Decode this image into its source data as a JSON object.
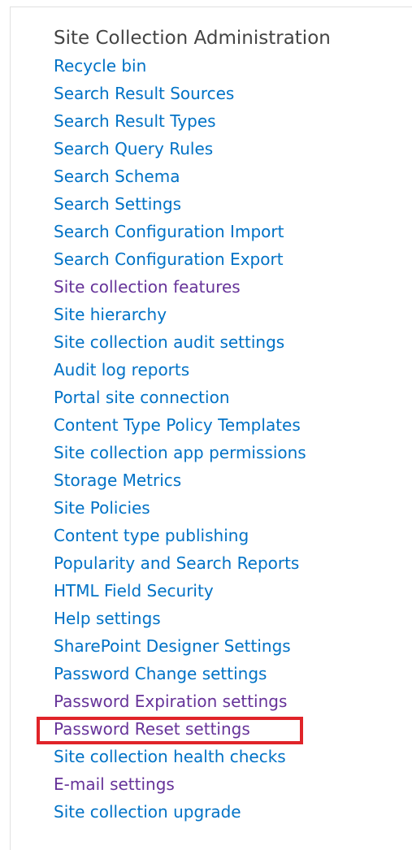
{
  "section": {
    "title": "Site Collection Administration",
    "title_color": "#444444",
    "link_color": "#0072c6",
    "visited_color": "#663399",
    "highlight_color": "#e02429",
    "links": [
      {
        "label": "Recycle bin",
        "visited": false
      },
      {
        "label": "Search Result Sources",
        "visited": false
      },
      {
        "label": "Search Result Types",
        "visited": false
      },
      {
        "label": "Search Query Rules",
        "visited": false
      },
      {
        "label": "Search Schema",
        "visited": false
      },
      {
        "label": "Search Settings",
        "visited": false
      },
      {
        "label": "Search Configuration Import",
        "visited": false
      },
      {
        "label": "Search Configuration Export",
        "visited": false
      },
      {
        "label": "Site collection features",
        "visited": true
      },
      {
        "label": "Site hierarchy",
        "visited": false
      },
      {
        "label": "Site collection audit settings",
        "visited": false
      },
      {
        "label": "Audit log reports",
        "visited": false
      },
      {
        "label": "Portal site connection",
        "visited": false
      },
      {
        "label": "Content Type Policy Templates",
        "visited": false
      },
      {
        "label": "Site collection app permissions",
        "visited": false
      },
      {
        "label": "Storage Metrics",
        "visited": false
      },
      {
        "label": "Site Policies",
        "visited": false
      },
      {
        "label": "Content type publishing",
        "visited": false
      },
      {
        "label": "Popularity and Search Reports",
        "visited": false
      },
      {
        "label": "HTML Field Security",
        "visited": false
      },
      {
        "label": "Help settings",
        "visited": false
      },
      {
        "label": "SharePoint Designer Settings",
        "visited": false
      },
      {
        "label": "Password Change settings",
        "visited": false
      },
      {
        "label": "Password Expiration settings",
        "visited": true
      },
      {
        "label": "Password Reset settings",
        "visited": true,
        "highlighted": true
      },
      {
        "label": "Site collection health checks",
        "visited": false
      },
      {
        "label": "E-mail settings",
        "visited": true
      },
      {
        "label": "Site collection upgrade",
        "visited": false
      }
    ]
  }
}
